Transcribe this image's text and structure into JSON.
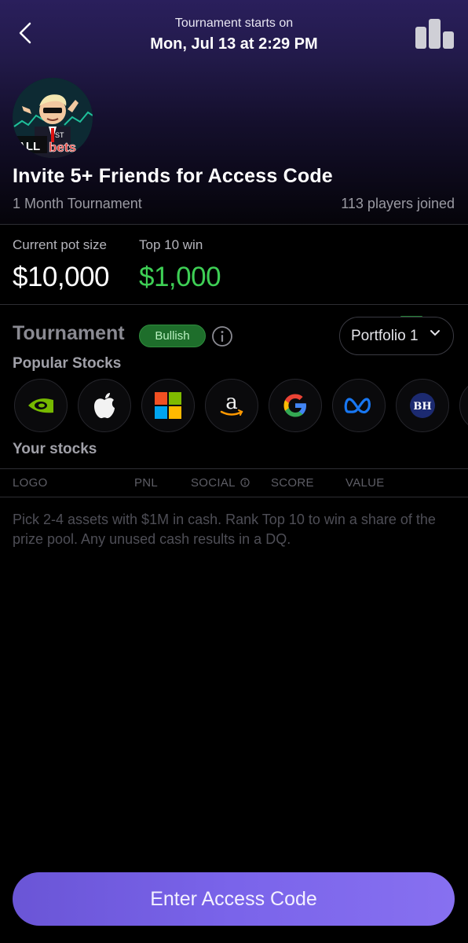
{
  "header": {
    "subtitle": "Tournament starts on",
    "date": "Mon, Jul 13 at 2:29 PM"
  },
  "avatar": {
    "sign_text_1": "ALL",
    "sign_text_2": "ST",
    "sign_text_3": "bets"
  },
  "tournament": {
    "title": "Invite 5+ Friends for Access Code",
    "duration": "1 Month Tournament",
    "players": "113 players joined"
  },
  "pot": {
    "pot_label": "Current pot size",
    "pot_value": "$10,000",
    "win_label": "Top 10 win",
    "win_value": "$1,000",
    "win_color": "#3ecf55"
  },
  "section": {
    "title": "Tournament",
    "badge": "Bullish",
    "badge_color": "#1e6e2b",
    "portfolio": "Portfolio 1"
  },
  "popular": {
    "label": "Popular Stocks",
    "stocks": [
      "nvidia-logo",
      "apple-logo",
      "microsoft-logo",
      "amazon-logo",
      "google-logo",
      "meta-logo",
      "bh-logo"
    ],
    "bh_text": "BH"
  },
  "your_stocks": {
    "label": "Your stocks",
    "columns": [
      "LOGO",
      "PNL",
      "SOCIAL",
      "SCORE",
      "VALUE"
    ],
    "empty_hint": "Pick 2-4 assets with $1M in cash. Rank Top 10 to win a share of the prize pool. Any unused cash results in a DQ."
  },
  "cta": {
    "label": "Enter Access Code",
    "color": "#7a64ea"
  }
}
